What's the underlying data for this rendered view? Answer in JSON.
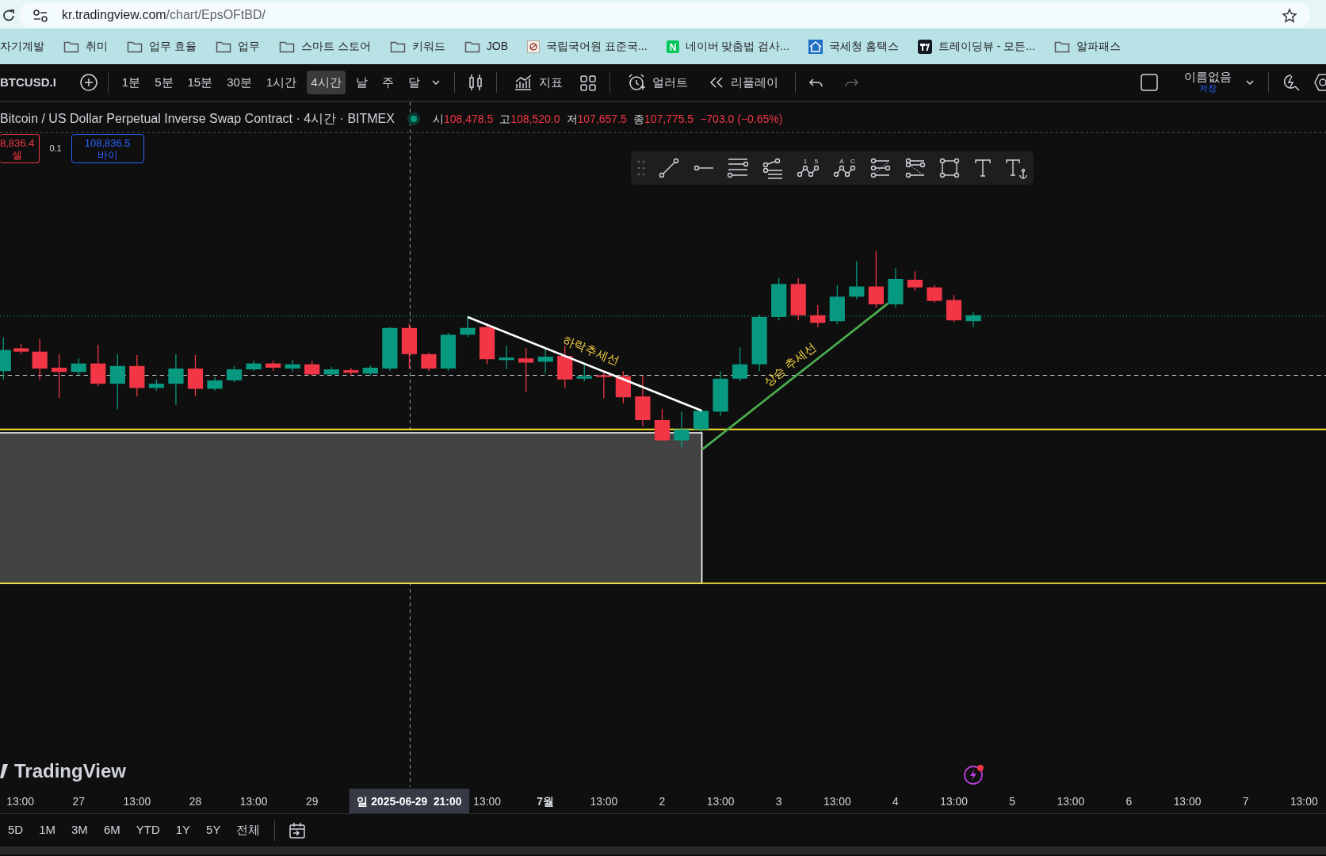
{
  "browser": {
    "url": {
      "host": "kr.tradingview.com",
      "path": "/chart/EpsOFtBD/"
    }
  },
  "bookmarks": [
    {
      "kind": "plain",
      "label": "자기계발"
    },
    {
      "kind": "folder",
      "label": "취미"
    },
    {
      "kind": "folder",
      "label": "업무 효율"
    },
    {
      "kind": "folder",
      "label": "업무"
    },
    {
      "kind": "folder",
      "label": "스마트 스토어"
    },
    {
      "kind": "folder",
      "label": "키워드"
    },
    {
      "kind": "folder",
      "label": "JOB"
    },
    {
      "kind": "dictionary",
      "label": "국립국어원 표준국..."
    },
    {
      "kind": "letter",
      "badge": "N",
      "label": "네이버 맞춤법 검사..."
    },
    {
      "kind": "house",
      "label": "국세청 홈택스"
    },
    {
      "kind": "tradingview",
      "label": "트레이딩뷰 - 모든..."
    },
    {
      "kind": "folder",
      "label": "알파패스"
    }
  ],
  "toolbar": {
    "symbol": "BTCUSD.I",
    "intervals": [
      {
        "label": "1분",
        "selected": false
      },
      {
        "label": "5분",
        "selected": false
      },
      {
        "label": "15분",
        "selected": false
      },
      {
        "label": "30분",
        "selected": false
      },
      {
        "label": "1시간",
        "selected": false
      },
      {
        "label": "4시간",
        "selected": true
      },
      {
        "label": "날",
        "selected": false
      },
      {
        "label": "주",
        "selected": false
      },
      {
        "label": "달",
        "selected": false
      }
    ],
    "indicators_label": "지표",
    "alert_label": "얼러트",
    "replay_label": "리플레이",
    "undo": {
      "disabled": false
    },
    "redo": {
      "disabled": true
    },
    "layout_name": "이름없음",
    "save_label": "저장"
  },
  "chart": {
    "title": "Bitcoin / US Dollar Perpetual Inverse Swap Contract · 4시간 · BITMEX",
    "market_open": true,
    "ohlc": [
      {
        "label": "시",
        "value": "108,478.5"
      },
      {
        "label": "고",
        "value": "108,520.0"
      },
      {
        "label": "저",
        "value": "107,657.5"
      },
      {
        "label": "종",
        "value": "107,775.5"
      }
    ],
    "change": "−703.0 (−0.65%)",
    "order_panel": {
      "sell_price": "8,836.4",
      "sell_label": "셀",
      "quantity": "0.1",
      "buy_price": "108,836.5",
      "buy_label": "바이"
    },
    "drawing_tools": [
      {
        "kind": "grip"
      },
      {
        "kind": "trend-line"
      },
      {
        "kind": "ray"
      },
      {
        "kind": "parallel"
      },
      {
        "kind": "fan"
      },
      {
        "kind": "wave",
        "marks": [
          "1",
          "5"
        ]
      },
      {
        "kind": "wave",
        "marks": [
          "A",
          "C"
        ]
      },
      {
        "kind": "channel-up"
      },
      {
        "kind": "channel-down"
      },
      {
        "kind": "rectangle"
      },
      {
        "kind": "text"
      },
      {
        "kind": "anchored-text"
      }
    ],
    "annotations": [
      {
        "kind": "falling",
        "text": "하락추세선"
      },
      {
        "kind": "rising",
        "text": "상승 추세선"
      }
    ],
    "logo_text": "TradingView"
  },
  "time_axis": {
    "ticks": [
      {
        "kind": "time",
        "label": "13:00"
      },
      {
        "kind": "day",
        "label": "27"
      },
      {
        "kind": "time",
        "label": "13:00"
      },
      {
        "kind": "day",
        "label": "28"
      },
      {
        "kind": "time",
        "label": "13:00"
      },
      {
        "kind": "day",
        "label": "29"
      },
      {
        "kind": "cursor",
        "label": "일 2025-06-29  21:00"
      },
      {
        "kind": "time",
        "label": "13:00"
      },
      {
        "kind": "month",
        "label": "7월"
      },
      {
        "kind": "time",
        "label": "13:00"
      },
      {
        "kind": "day",
        "label": "2"
      },
      {
        "kind": "time",
        "label": "13:00"
      },
      {
        "kind": "day",
        "label": "3"
      },
      {
        "kind": "time",
        "label": "13:00"
      },
      {
        "kind": "day",
        "label": "4"
      },
      {
        "kind": "time",
        "label": "13:00"
      },
      {
        "kind": "day",
        "label": "5"
      },
      {
        "kind": "time",
        "label": "13:00"
      },
      {
        "kind": "day",
        "label": "6"
      },
      {
        "kind": "time",
        "label": "13:00"
      },
      {
        "kind": "day",
        "label": "7"
      },
      {
        "kind": "time",
        "label": "13:00"
      }
    ]
  },
  "ranges": [
    "5D",
    "1M",
    "3M",
    "6M",
    "YTD",
    "1Y",
    "5Y",
    "전체"
  ]
}
